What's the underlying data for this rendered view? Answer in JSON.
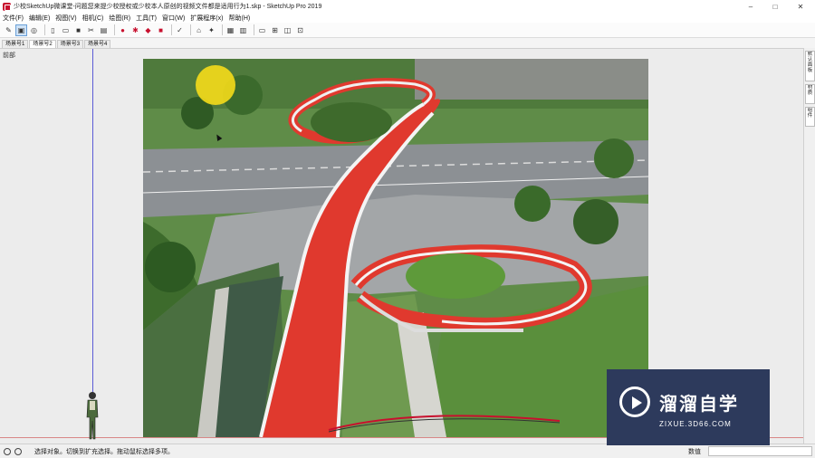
{
  "window": {
    "title": "少校SketchUp微课堂-问题您来提少校授权或少校本人原创的视频文件都是适用行为1.skp - SketchUp Pro 2019",
    "minimize": "–",
    "maximize": "□",
    "close": "✕"
  },
  "menu": [
    "文件(F)",
    "编辑(E)",
    "视图(V)",
    "相机(C)",
    "绘图(R)",
    "工具(T)",
    "窗口(W)",
    "扩展程序(x)",
    "帮助(H)"
  ],
  "scenes": [
    "场景号1",
    "场景号2",
    "场景号3",
    "场景号4"
  ],
  "viewport": {
    "label": "前部"
  },
  "right_panel": {
    "tabs": [
      "默认面板",
      "材质",
      "组件"
    ]
  },
  "status": {
    "text": "选择对象。切换到扩充选择。拖动鼠标选择多项。",
    "measure_label": "数值",
    "measure_value": ""
  },
  "watermark": {
    "brand": "溜溜自学",
    "url": "ZIXUE.3D66.COM"
  },
  "colors": {
    "accent": "#c8102e",
    "bridge": "#e0392e",
    "watermark_bg": "#2d3a5c",
    "blue_axis": "#5b5bd6"
  }
}
